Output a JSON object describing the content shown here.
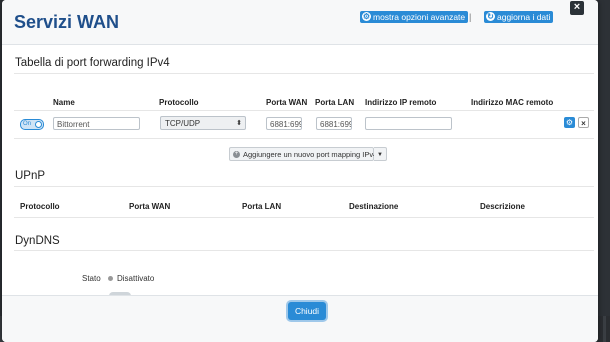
{
  "modal": {
    "title": "Servizi WAN",
    "header_links": {
      "advanced": "mostra opzioni avanzate",
      "separator": "|",
      "refresh": "aggiorna i dati"
    },
    "close_icon": "×"
  },
  "port_forwarding": {
    "title": "Tabella di port forwarding IPv4",
    "columns": [
      "Name",
      "Protocollo",
      "Porta WAN",
      "Porta LAN",
      "Indirizzo IP remoto",
      "Indirizzo MAC remoto"
    ],
    "row": {
      "toggle_label": "On",
      "name_placeholder": "Bittorrent",
      "protocol": "TCP/UDP",
      "porta_wan": "6881:699",
      "porta_lan": "6881:699",
      "ip_remoto": "",
      "edit_icon": "gear-icon",
      "delete_icon": "close-icon"
    },
    "add_button": "Aggiungere un nuovo port mapping IPv4"
  },
  "upnp": {
    "title": "UPnP",
    "columns": [
      "Protocollo",
      "Porta WAN",
      "Porta LAN",
      "Destinazione",
      "Descrizione"
    ]
  },
  "dyndns": {
    "title": "DynDNS",
    "stato_label": "Stato",
    "stato_value": "Disattivato"
  },
  "footer": {
    "close_button": "Chiudi"
  },
  "colors": {
    "accent": "#2a8bd6",
    "title": "#1f4f8b"
  }
}
